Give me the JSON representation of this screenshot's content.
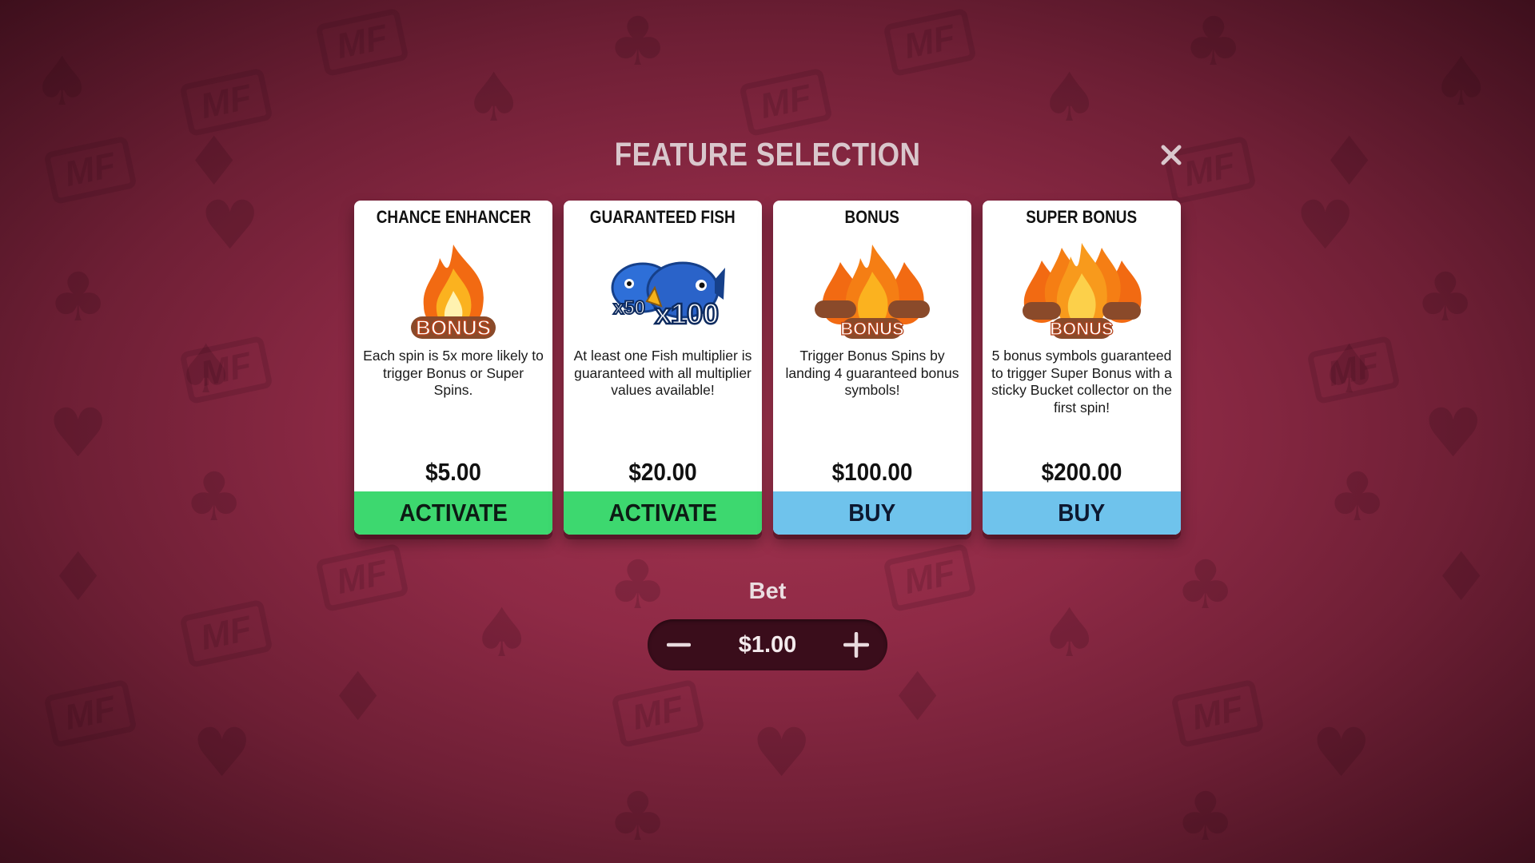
{
  "title": "FEATURE SELECTION",
  "close_icon": "close-icon",
  "cards": [
    {
      "title": "CHANCE ENHANCER",
      "art_text": "BONUS",
      "description": "Each spin is 5x more likely to trigger Bonus or Super Spins.",
      "price": "$5.00",
      "button": "ACTIVATE",
      "button_color": "#3dd86f"
    },
    {
      "title": "GUARANTEED FISH",
      "art_text_small": "x50",
      "art_text_large": "x100",
      "description": "At least one Fish multiplier is guaranteed with all multiplier values available!",
      "price": "$20.00",
      "button": "ACTIVATE",
      "button_color": "#3dd86f"
    },
    {
      "title": "BONUS",
      "art_text": "BONUS",
      "description": "Trigger Bonus Spins by landing 4 guaranteed bonus symbols!",
      "price": "$100.00",
      "button": "BUY",
      "button_color": "#6fc3ec"
    },
    {
      "title": "SUPER BONUS",
      "art_text": "BONUS",
      "description": "5 bonus symbols guaranteed to trigger Super Bonus with a sticky Bucket collector on the first spin!",
      "price": "$200.00",
      "button": "BUY",
      "button_color": "#6fc3ec"
    }
  ],
  "bet": {
    "label": "Bet",
    "value": "$1.00",
    "minus_icon": "minus-icon",
    "plus_icon": "plus-icon"
  },
  "background_logo": "MF"
}
